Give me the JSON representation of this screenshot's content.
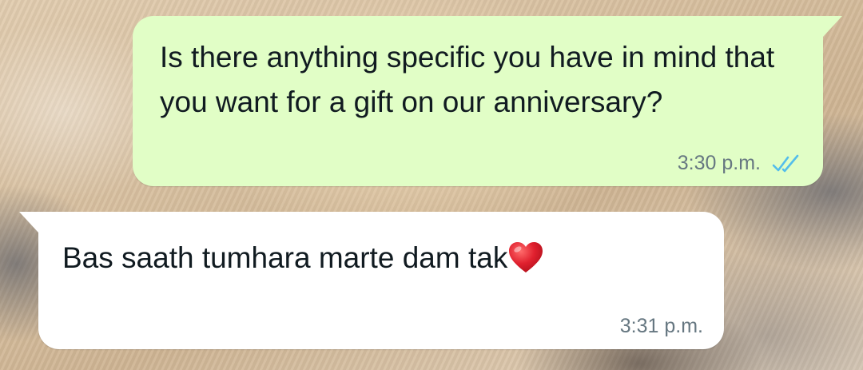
{
  "conversation": {
    "messages": [
      {
        "direction": "outgoing",
        "text": "Is there anything specific you have in mind that you want for a gift on our anniversary?",
        "time": "3:30 p.m.",
        "status_icon": "double-check-read-icon"
      },
      {
        "direction": "incoming",
        "text": "Bas saath tumhara marte dam tak",
        "emoji": "red-heart-icon",
        "time": "3:31 p.m."
      }
    ]
  },
  "colors": {
    "outgoing_bubble": "#e1fec6",
    "incoming_bubble": "#ffffff",
    "message_text": "#111b21",
    "timestamp": "#667781",
    "read_ticks": "#53bdeb",
    "heart": "#e0202e"
  }
}
